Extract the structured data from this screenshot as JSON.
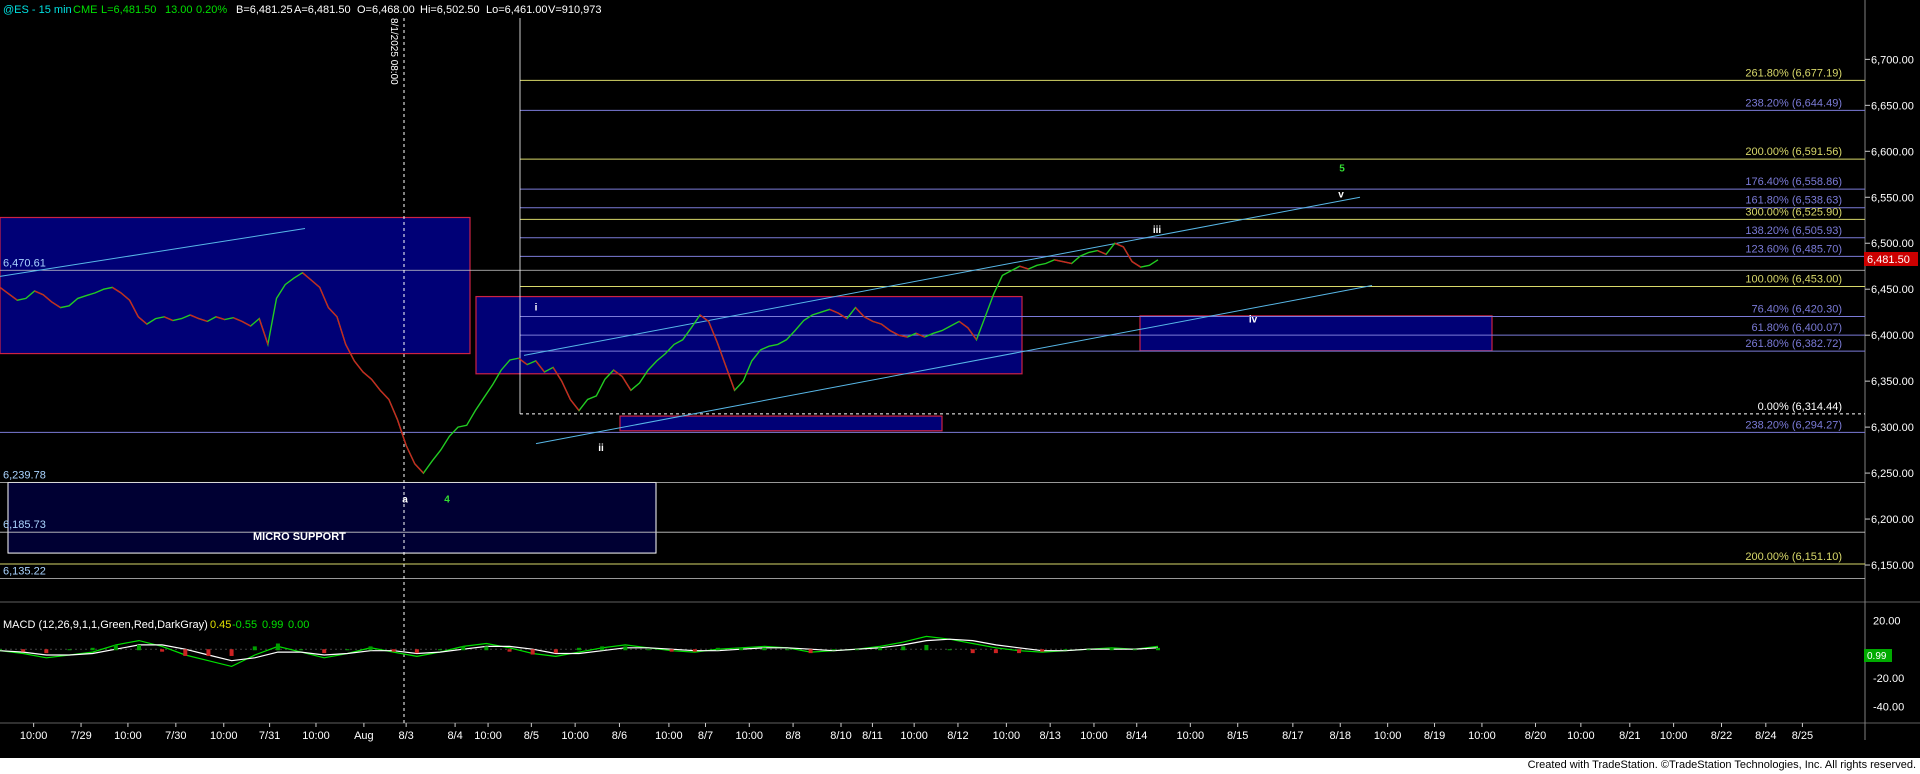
{
  "header": {
    "symbol": "@ES - 15 min",
    "exchange": "CME",
    "last": "L=6,481.50",
    "change": "13.00",
    "pct": "0.20%",
    "bid": "B=6,481.25",
    "ask": "A=6,481.50",
    "open": "O=6,468.00",
    "high": "Hi=6,502.50",
    "low": "Lo=6,461.00",
    "volume": "V=910,973"
  },
  "footer": {
    "text": "Created with TradeStation. ©TradeStation Technologies, Inc. All rights reserved."
  },
  "vline_label": "8/1/2025 08:00",
  "last_price_tag": "6,481.50",
  "colors": {
    "background": "#000000",
    "up_bar": "#22cc22",
    "down_bar": "#cc2222",
    "box_fill": "#00008b",
    "box_border": "#cc2244",
    "yellow_line": "#d8d86a",
    "blue_line": "#7b7bd8",
    "trend_line": "#58b8e8",
    "grid": "#404040"
  },
  "chart_data": [
    {
      "type": "line",
      "title": "",
      "y_axis": {
        "ticks": [
          "6,700.00",
          "6,650.00",
          "6,600.00",
          "6,550.00",
          "6,500.00",
          "6,450.00",
          "6,400.00",
          "6,350.00",
          "6,300.00",
          "6,250.00",
          "6,200.00",
          "6,150.00"
        ],
        "range": [
          6125,
          6745
        ]
      },
      "x_axis": {
        "ticks": [
          "10:00",
          "7/29",
          "10:00",
          "7/30",
          "10:00",
          "7/31",
          "10:00",
          "Aug",
          "8/3",
          "8/4",
          "10:00",
          "8/5",
          "10:00",
          "8/6",
          "10:00",
          "8/7",
          "10:00",
          "8/8",
          "8/10",
          "8/11",
          "10:00",
          "8/12",
          "10:00",
          "8/13",
          "10:00",
          "8/14",
          "10:00",
          "8/15",
          "8/17",
          "8/18",
          "10:00",
          "8/19",
          "10:00",
          "8/20",
          "10:00",
          "8/21",
          "10:00",
          "8/22",
          "8/24",
          "8/25"
        ]
      },
      "series": [
        {
          "values": [
            6452,
            6445,
            6438,
            6440,
            6448,
            6444,
            6436,
            6430,
            6432,
            6440,
            6443,
            6446,
            6450,
            6452,
            6446,
            6438,
            6420,
            6412,
            6418,
            6420,
            6416,
            6418,
            6422,
            6418,
            6415,
            6420,
            6417,
            6419,
            6415,
            6410,
            6418,
            6390,
            6440,
            6455,
            6462,
            6468,
            6460,
            6452,
            6430,
            6420,
            6390,
            6372,
            6360,
            6352,
            6340,
            6330,
            6308,
            6280,
            6260,
            6250,
            6263,
            6275,
            6290,
            6300,
            6302,
            6318,
            6332,
            6346,
            6362,
            6373,
            6375,
            6368,
            6372,
            6360,
            6365,
            6350,
            6330,
            6318,
            6330,
            6334,
            6352,
            6362,
            6355,
            6340,
            6348,
            6362,
            6372,
            6380,
            6390,
            6395,
            6408,
            6422,
            6415,
            6392,
            6366,
            6340,
            6350,
            6372,
            6384,
            6388,
            6390,
            6395,
            6405,
            6416,
            6422,
            6425,
            6428,
            6424,
            6418,
            6430,
            6420,
            6415,
            6412,
            6405,
            6400,
            6398,
            6402,
            6398,
            6402,
            6405,
            6410,
            6415,
            6408,
            6395,
            6420,
            6445,
            6465,
            6470,
            6475,
            6472,
            6476,
            6478,
            6482,
            6480,
            6478,
            6486,
            6490,
            6492,
            6488,
            6500,
            6496,
            6480,
            6474,
            6476,
            6482
          ]
        }
      ],
      "levels": [
        {
          "label": "261.80% (6,677.19)",
          "value": 6677.19,
          "color": "yellow"
        },
        {
          "label": "238.20% (6,644.49)",
          "value": 6644.49,
          "color": "blue"
        },
        {
          "label": "200.00% (6,591.56)",
          "value": 6591.56,
          "color": "yellow"
        },
        {
          "label": "176.40% (6,558.86)",
          "value": 6558.86,
          "color": "blue"
        },
        {
          "label": "161.80% (6,538.63)",
          "value": 6538.63,
          "color": "blue"
        },
        {
          "label": "300.00% (6,525.90)",
          "value": 6525.9,
          "color": "yellow"
        },
        {
          "label": "138.20% (6,505.93)",
          "value": 6505.93,
          "color": "blue"
        },
        {
          "label": "123.60% (6,485.70)",
          "value": 6485.7,
          "color": "blue"
        },
        {
          "label": "100.00% (6,453.00)",
          "value": 6453.0,
          "color": "yellow"
        },
        {
          "label": "76.40% (6,420.30)",
          "value": 6420.3,
          "color": "blue"
        },
        {
          "label": "61.80% (6,400.07)",
          "value": 6400.07,
          "color": "blue"
        },
        {
          "label": "261.80% (6,382.72)",
          "value": 6382.72,
          "color": "blue"
        },
        {
          "label": "0.00% (6,314.44)",
          "value": 6314.44,
          "color": "white"
        },
        {
          "label": "238.20% (6,294.27)",
          "value": 6294.27,
          "color": "blue"
        },
        {
          "label": "200.00% (6,151.10)",
          "value": 6151.1,
          "color": "yellow"
        }
      ],
      "left_levels": [
        {
          "label": "6,470.61",
          "value": 6470.61
        },
        {
          "label": "6,239.78",
          "value": 6239.78
        },
        {
          "label": "6,185.73",
          "value": 6185.73
        },
        {
          "label": "6,135.22",
          "value": 6135.22
        }
      ],
      "wave_labels": [
        "5",
        "v",
        "iii",
        "iv",
        "i",
        "ii",
        "a",
        "4"
      ],
      "annotations": [
        "MICRO SUPPORT"
      ]
    },
    {
      "type": "line",
      "title": "MACD (12,26,9,1,1,Green,Red,DarkGray)",
      "readouts": [
        "0.45",
        "-0.55",
        "0.99",
        "0.00"
      ],
      "y_axis": {
        "ticks": [
          "20.00",
          "-20.00",
          "-40.00"
        ],
        "range": [
          -48,
          26
        ]
      },
      "last_value": "0.99",
      "series": [
        {
          "name": "MACD",
          "values": [
            -1,
            -3,
            -6,
            -4,
            -2,
            3,
            6,
            2,
            -4,
            -8,
            -12,
            -4,
            2,
            -2,
            -6,
            -3,
            1,
            -2,
            -5,
            -2,
            2,
            4,
            1,
            -3,
            -5,
            -2,
            1,
            3,
            1,
            -1,
            -2,
            0,
            1,
            2,
            1,
            -2,
            -1,
            0,
            2,
            5,
            9,
            7,
            4,
            1,
            -1,
            -2,
            -1,
            0,
            1,
            0,
            2
          ]
        },
        {
          "name": "Signal",
          "values": [
            -1,
            -2,
            -4,
            -4,
            -3,
            0,
            3,
            3,
            0,
            -4,
            -8,
            -6,
            -2,
            -2,
            -4,
            -3,
            -1,
            -1,
            -3,
            -2,
            0,
            2,
            2,
            0,
            -3,
            -3,
            -1,
            1,
            1,
            0,
            -1,
            -1,
            0,
            1,
            1,
            0,
            -1,
            0,
            1,
            3,
            6,
            7,
            6,
            3,
            1,
            -1,
            -1,
            0,
            0,
            0,
            1
          ]
        }
      ]
    }
  ]
}
